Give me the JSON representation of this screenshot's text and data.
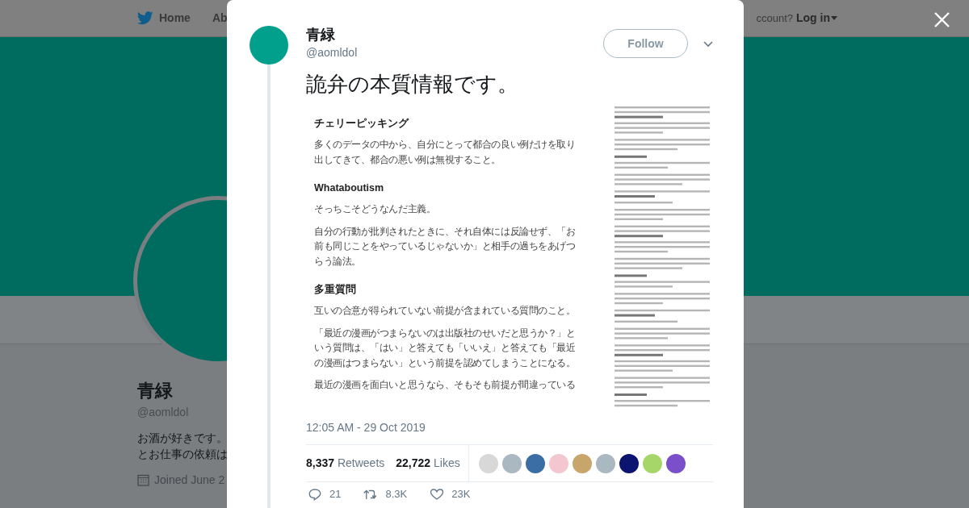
{
  "nav": {
    "home": "Home",
    "about": "Ab",
    "account_prompt": "ccount?",
    "login": "Log in"
  },
  "profile": {
    "name": "青緑",
    "handle": "@aomldol",
    "bio": [
      "お酒が好きです。",
      "とお仕事の依頼は"
    ],
    "joined": "Joined June 2"
  },
  "tweet": {
    "name": "青緑",
    "handle": "@aomldol",
    "follow": "Follow",
    "text": "詭弁の本質情報です。",
    "image_blocks": [
      {
        "kind": "heading",
        "text": "チェリーピッキング"
      },
      {
        "kind": "paragraph",
        "lines": [
          "多くのデータの中から、自分にとって都合の良い例だけを取り",
          "出してきて、都合の悪い例は無視すること。"
        ]
      },
      {
        "kind": "heading",
        "text": "Whataboutism"
      },
      {
        "kind": "paragraph",
        "lines": [
          "そっちこそどうなんだ主義。"
        ]
      },
      {
        "kind": "paragraph",
        "lines": [
          "自分の行動が批判されたときに、それ自体には反論せず、「お",
          "前も同じことをやっているじゃないか」と相手の過ちをあげつ",
          "らう論法。"
        ]
      },
      {
        "kind": "heading",
        "text": "多重質問"
      },
      {
        "kind": "paragraph",
        "lines": [
          "互いの合意が得られていない前提が含まれている質問のこと。"
        ]
      },
      {
        "kind": "paragraph",
        "lines": [
          "「最近の漫画がつまらないのは出版社のせいだと思うか？」と",
          "いう質問は、「はい」と答えても「いいえ」と答えても「最近",
          "の漫画はつまらない」という前提を認めてしまうことになる。"
        ]
      },
      {
        "kind": "paragraph",
        "lines": [
          "最近の漫画を面白いと思うなら、そもそも前提が間違っている"
        ]
      }
    ],
    "timestamp": "12:05 AM - 29 Oct 2019",
    "retweets": {
      "count": "8,337",
      "label": "Retweets"
    },
    "likes": {
      "count": "22,722",
      "label": "Likes"
    },
    "actions": [
      {
        "kind": "reply",
        "count": "21"
      },
      {
        "kind": "retweet",
        "count": "8.3K"
      },
      {
        "kind": "like",
        "count": "23K"
      }
    ]
  }
}
